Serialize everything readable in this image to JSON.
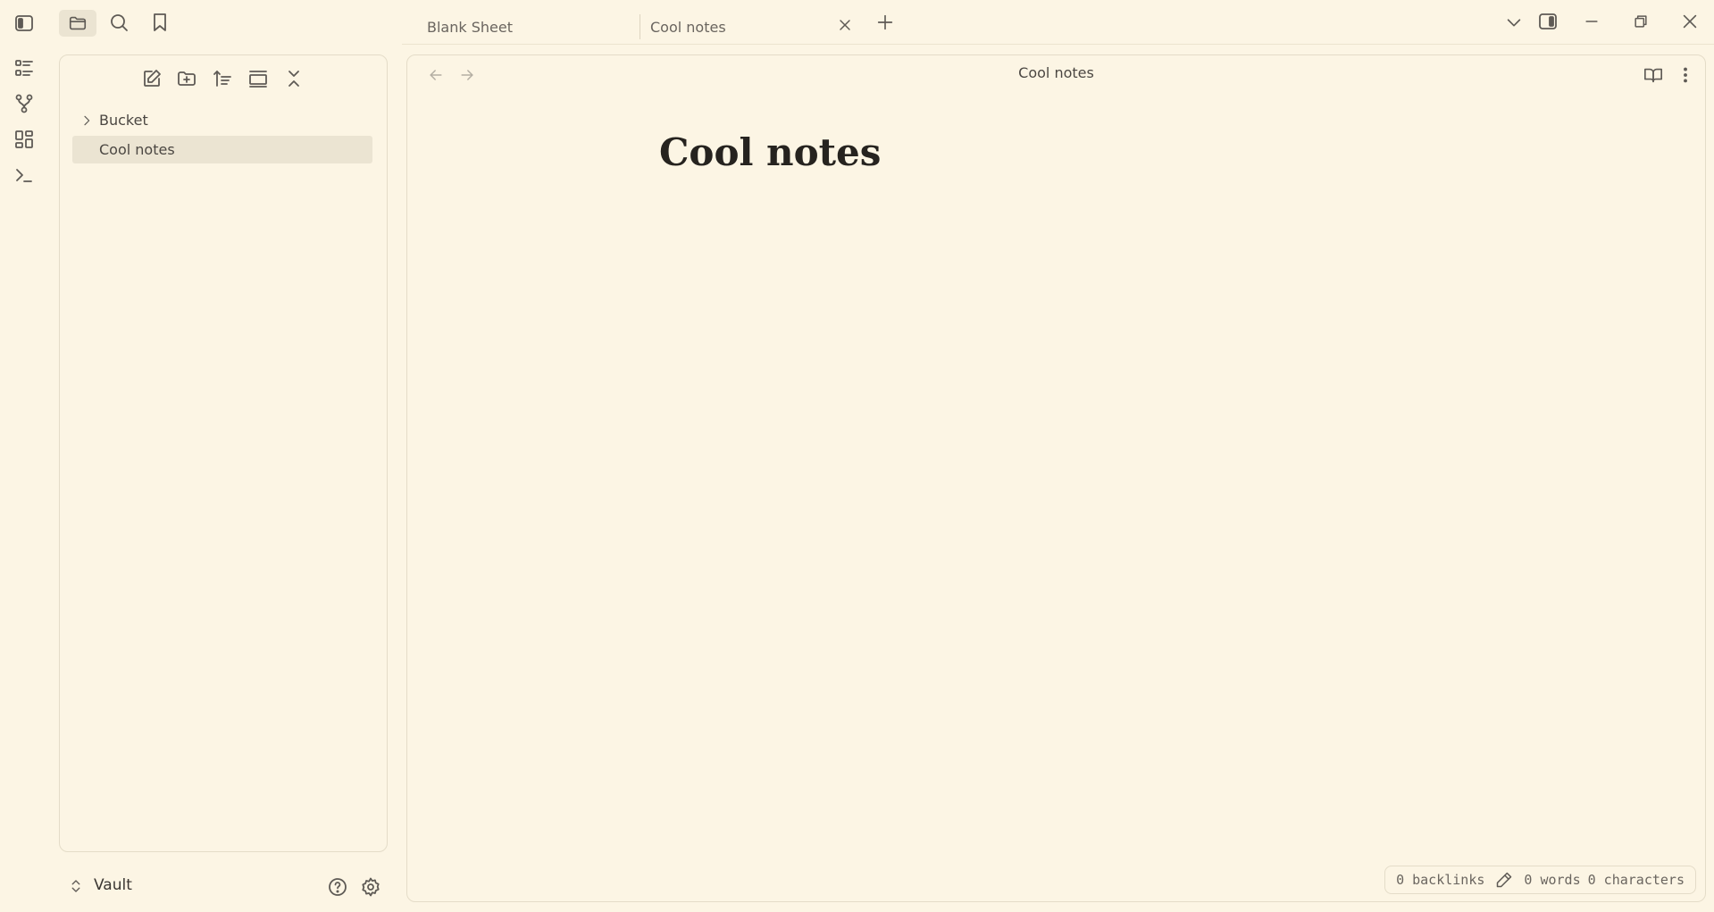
{
  "tabs": [
    {
      "label": "Blank Sheet"
    },
    {
      "label": "Cool notes"
    }
  ],
  "sidebar": {
    "items": [
      {
        "label": "Bucket",
        "type": "folder"
      },
      {
        "label": "Cool notes",
        "type": "file"
      }
    ]
  },
  "editor": {
    "view_title": "Cool notes",
    "heading": "Cool notes"
  },
  "status": {
    "backlinks": "0 backlinks",
    "words": "0 words",
    "characters": "0 characters"
  },
  "vault": {
    "name": "Vault"
  }
}
